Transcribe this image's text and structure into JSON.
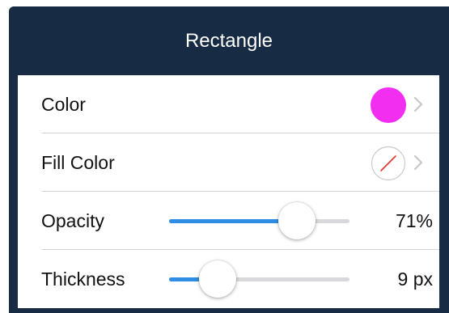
{
  "panel": {
    "title": "Rectangle"
  },
  "rows": {
    "color": {
      "label": "Color",
      "swatch_color": "#f22ef0",
      "chevron_icon": "chevron-right-icon"
    },
    "fill_color": {
      "label": "Fill Color",
      "swatch_icon": "no-fill-icon",
      "chevron_icon": "chevron-right-icon"
    },
    "opacity": {
      "label": "Opacity",
      "value_text": "71%",
      "level": 0.71
    },
    "thickness": {
      "label": "Thickness",
      "value_text": "9 px",
      "level": 0.27
    }
  },
  "colors": {
    "header_background": "#172b44",
    "slider_fill": "#2f8de3",
    "slider_track": "#d8d9dd",
    "no_fill_slash": "#e0332f"
  }
}
